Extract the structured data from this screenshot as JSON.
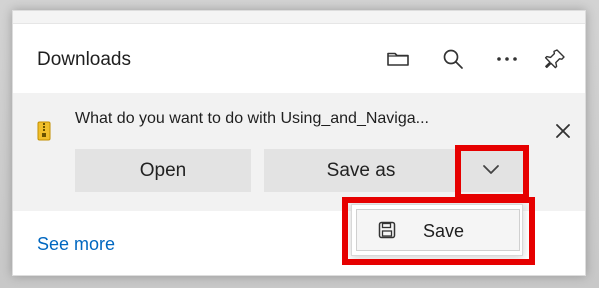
{
  "downloads": {
    "title": "Downloads",
    "prompt_text": "What do you want to do with Using_and_Naviga...",
    "buttons": {
      "open": "Open",
      "save_as": "Save as"
    },
    "see_more": "See more",
    "menu": {
      "save": "Save"
    },
    "icons": {
      "folder": "folder-icon",
      "search": "search-icon",
      "more": "more-options-icon",
      "pin": "pin-icon",
      "close": "close-icon",
      "chevron": "chevron-down-icon",
      "save": "save-icon",
      "file": "zip-file-icon"
    },
    "colors": {
      "highlight": "#e60000",
      "link": "#0067c0",
      "notice_bg": "#f2f2f2",
      "button_bg": "#e3e3e3"
    }
  }
}
